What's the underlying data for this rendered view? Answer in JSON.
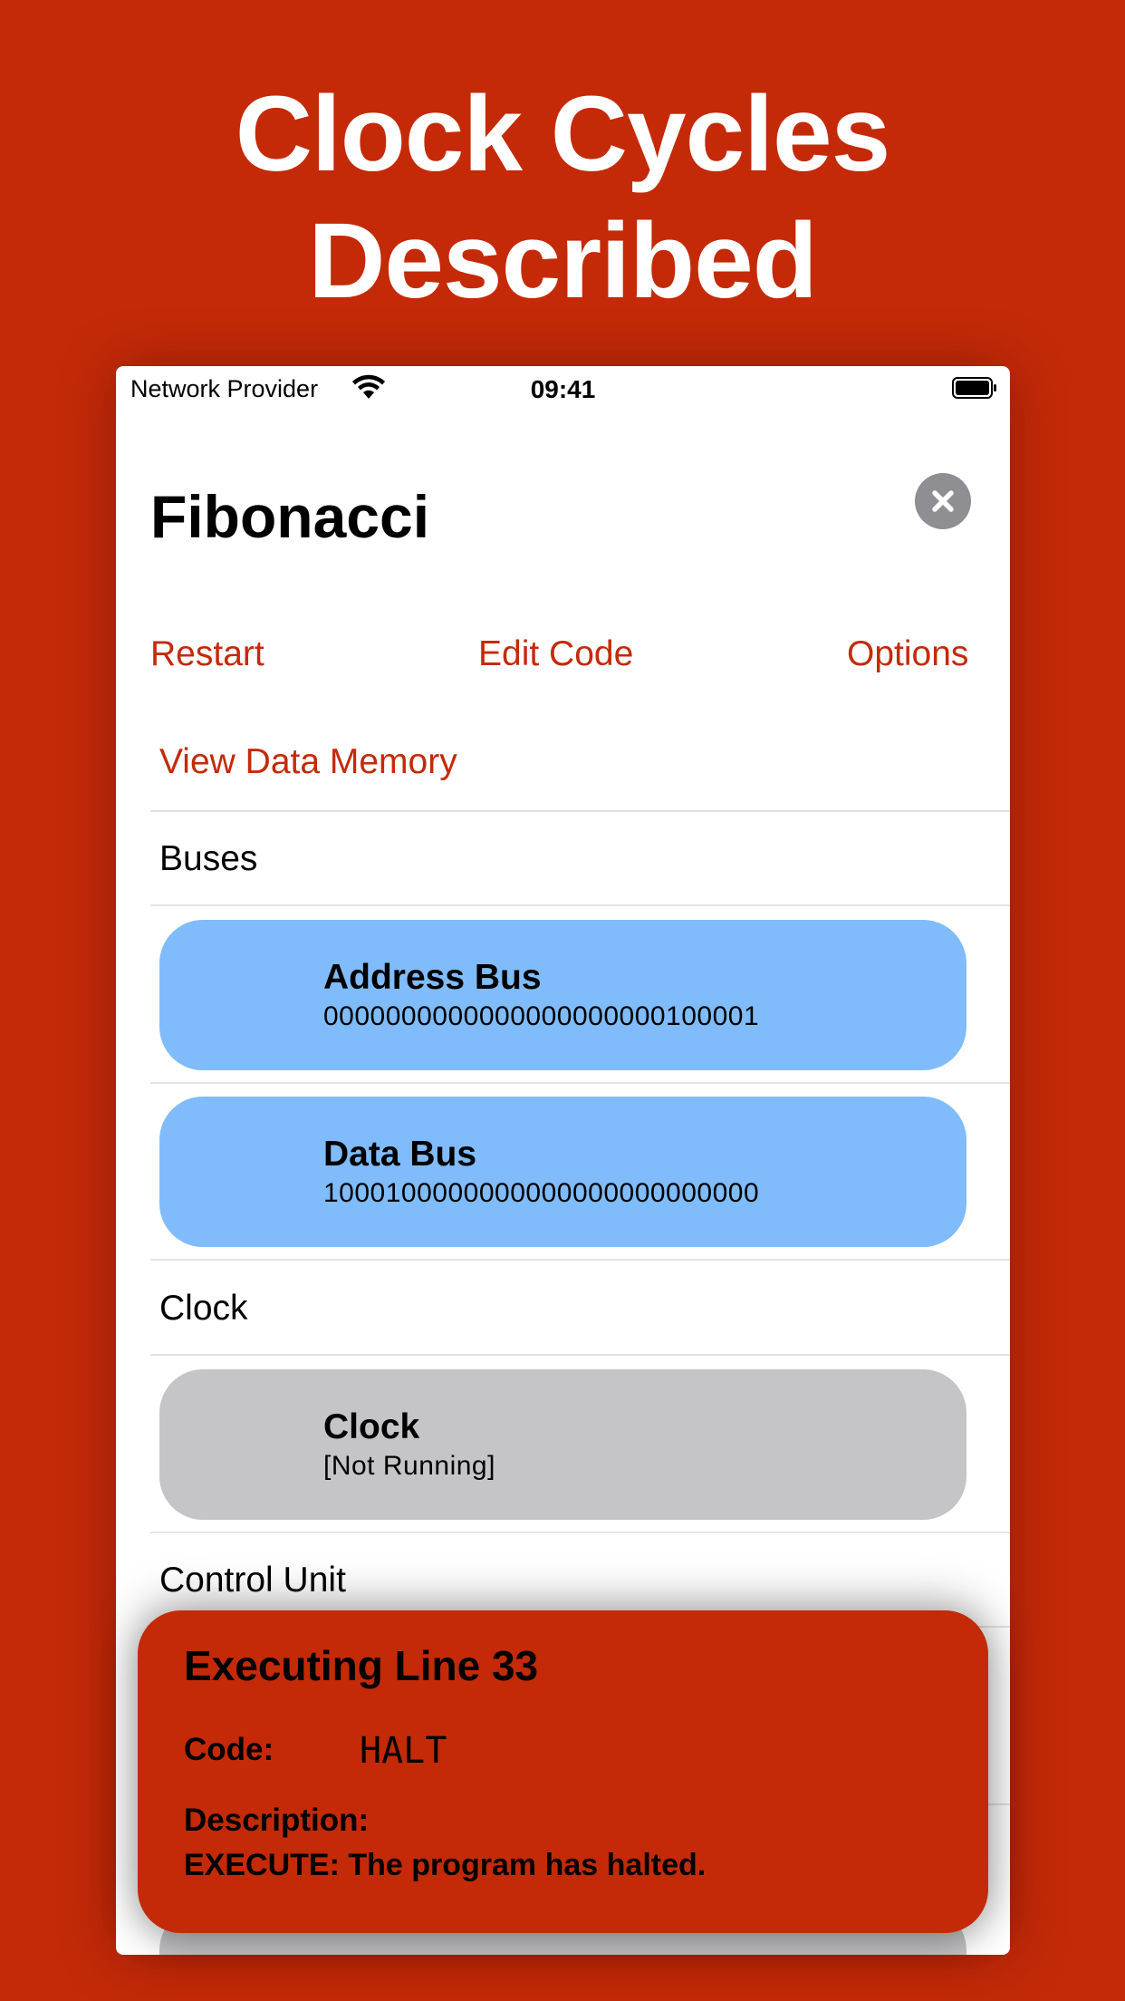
{
  "headline": {
    "line1": "Clock Cycles",
    "line2": "Described"
  },
  "status_bar": {
    "carrier": "Network Provider",
    "time": "09:41"
  },
  "screen": {
    "title": "Fibonacci",
    "toolbar": {
      "restart": "Restart",
      "edit_code": "Edit Code",
      "options": "Options"
    },
    "view_data_memory": "View Data Memory",
    "sections": {
      "buses": "Buses",
      "clock": "Clock",
      "control_unit": "Control Unit"
    },
    "address_bus": {
      "title": "Address Bus",
      "value": "0000000000000000000000100001"
    },
    "data_bus": {
      "title": "Data Bus",
      "value": "1000100000000000000000000000"
    },
    "clock_card": {
      "title": "Clock",
      "value": "[Not Running]"
    }
  },
  "popup": {
    "title": "Executing Line 33",
    "code_label": "Code:",
    "code_value": "HALT",
    "description_label": "Description:",
    "description_value": "EXECUTE: The program has halted."
  },
  "colors": {
    "accent": "#c42a08",
    "bus_card": "#80bcfc",
    "clock_card": "#c5c5c7",
    "close_button": "#8e8e93"
  },
  "icons": {
    "wifi": "wifi-icon",
    "battery": "battery-icon",
    "close": "close-icon"
  }
}
